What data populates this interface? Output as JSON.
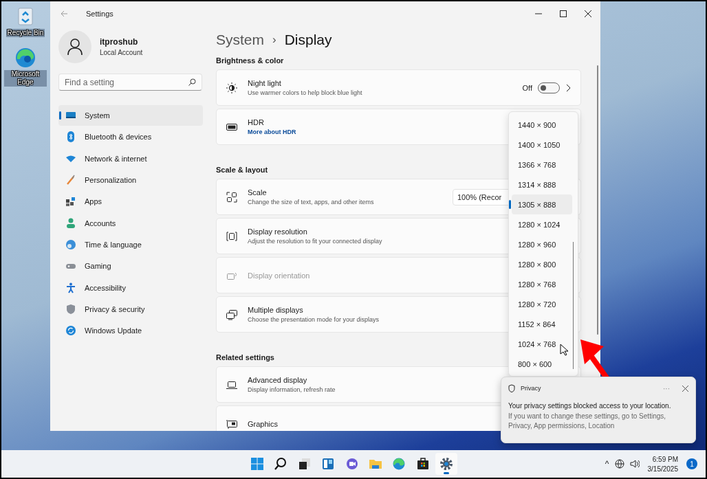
{
  "desktop_icons": [
    {
      "label": "Recycle Bin"
    },
    {
      "label": "Microsoft Edge"
    }
  ],
  "window": {
    "title": "Settings"
  },
  "profile": {
    "name": "itproshub",
    "account": "Local Account"
  },
  "search": {
    "placeholder": "Find a setting"
  },
  "nav": [
    {
      "label": "System",
      "selected": true
    },
    {
      "label": "Bluetooth & devices",
      "selected": false
    },
    {
      "label": "Network & internet",
      "selected": false
    },
    {
      "label": "Personalization",
      "selected": false
    },
    {
      "label": "Apps",
      "selected": false
    },
    {
      "label": "Accounts",
      "selected": false
    },
    {
      "label": "Time & language",
      "selected": false
    },
    {
      "label": "Gaming",
      "selected": false
    },
    {
      "label": "Accessibility",
      "selected": false
    },
    {
      "label": "Privacy & security",
      "selected": false
    },
    {
      "label": "Windows Update",
      "selected": false
    }
  ],
  "breadcrumb": {
    "parent": "System",
    "separator": "›",
    "current": "Display"
  },
  "sections": [
    {
      "heading": "Brightness & color",
      "cards": [
        {
          "title": "Night light",
          "description": "Use warmer colors to help block blue light",
          "disabled": false,
          "control": {
            "kind": "toggle",
            "label": "Off",
            "on": false
          }
        },
        {
          "title": "HDR",
          "link": "More about HDR",
          "disabled": false
        }
      ]
    },
    {
      "heading": "Scale & layout",
      "cards": [
        {
          "title": "Scale",
          "description": "Change the size of text, apps, and other items",
          "disabled": false,
          "control": {
            "kind": "combo",
            "value": "100% (Recor"
          }
        },
        {
          "title": "Display resolution",
          "description": "Adjust the resolution to fit your connected display",
          "disabled": false
        },
        {
          "title": "Display orientation",
          "disabled": true
        },
        {
          "title": "Multiple displays",
          "description": "Choose the presentation mode for your displays",
          "disabled": false
        }
      ]
    },
    {
      "heading": "Related settings",
      "cards": [
        {
          "title": "Advanced display",
          "description": "Display information, refresh rate",
          "disabled": false
        },
        {
          "title": "Graphics",
          "disabled": false
        }
      ]
    }
  ],
  "resolution_dropdown": {
    "options": [
      {
        "label": "1440 × 900",
        "selected": false
      },
      {
        "label": "1400 × 1050",
        "selected": false
      },
      {
        "label": "1366 × 768",
        "selected": false
      },
      {
        "label": "1314 × 888",
        "selected": false
      },
      {
        "label": "1305 × 888",
        "selected": true
      },
      {
        "label": "1280 × 1024",
        "selected": false
      },
      {
        "label": "1280 × 960",
        "selected": false
      },
      {
        "label": "1280 × 800",
        "selected": false
      },
      {
        "label": "1280 × 768",
        "selected": false
      },
      {
        "label": "1280 × 720",
        "selected": false
      },
      {
        "label": "1152 × 864",
        "selected": false
      },
      {
        "label": "1024 × 768",
        "selected": false
      },
      {
        "label": "800 × 600",
        "selected": false
      }
    ]
  },
  "notification": {
    "app": "Privacy",
    "more": "···",
    "title": "Your privacy settings blocked access to your location.",
    "body": "If you want to change these settings, go to Settings, Privacy, App permissions, Location"
  },
  "taskbar": {
    "apps": [
      {
        "selected": false
      },
      {
        "selected": false
      },
      {
        "selected": false
      },
      {
        "selected": false
      },
      {
        "selected": false
      },
      {
        "selected": false
      },
      {
        "selected": false
      },
      {
        "selected": false
      },
      {
        "selected": true
      }
    ],
    "tray_chevron": "^",
    "time": "6:59 PM",
    "date": "3/15/2025",
    "badge": "1"
  }
}
